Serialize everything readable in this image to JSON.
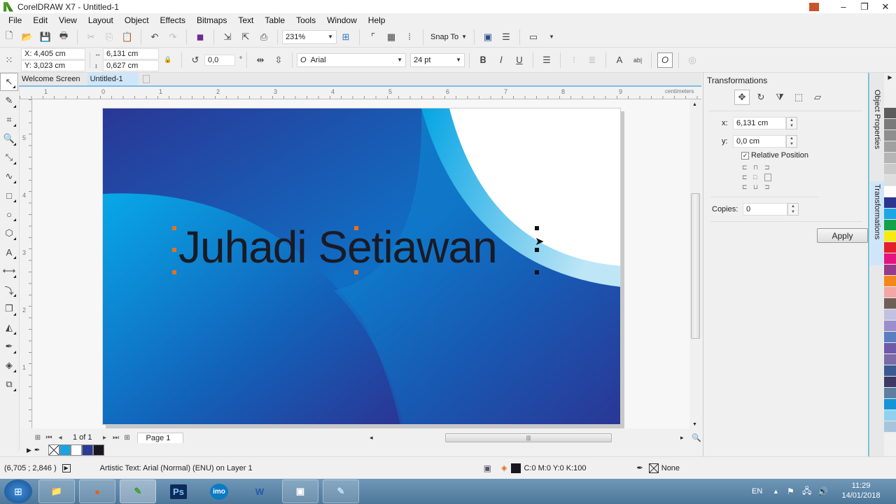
{
  "window": {
    "title": "CorelDRAW X7 - Untitled-1",
    "min": "–",
    "restore": "❐",
    "close": "✕"
  },
  "menu": [
    "File",
    "Edit",
    "View",
    "Layout",
    "Object",
    "Effects",
    "Bitmaps",
    "Text",
    "Table",
    "Tools",
    "Window",
    "Help"
  ],
  "standard_toolbar": {
    "zoom_level": "231%",
    "snap_to": "Snap To"
  },
  "property_bar": {
    "x": "X: 4,405 cm",
    "y": "Y: 3,023 cm",
    "width": "6,131 cm",
    "height": "0,627 cm",
    "rotation": "0,0",
    "degree_symbol": "°",
    "font": "Arial",
    "font_size": "24 pt"
  },
  "doc_tabs": [
    {
      "label": "Welcome Screen",
      "active": false
    },
    {
      "label": "Untitled-1",
      "active": true
    }
  ],
  "rulers": {
    "unit": "centimeters",
    "h_labels": [
      "1",
      "0",
      "1",
      "2",
      "3",
      "4",
      "5",
      "6",
      "7",
      "8",
      "9"
    ],
    "v_labels": [
      "5",
      "4",
      "3",
      "2",
      "1"
    ]
  },
  "canvas": {
    "text_object": "Juhadi Setiawan",
    "text_color": "#1a1a24"
  },
  "page_nav": {
    "counter": "1 of 1",
    "page_tab": "Page 1"
  },
  "document_palette": [
    "none",
    "#1aa3e0",
    "#ffffff",
    "#2b3a94",
    "#1a1620"
  ],
  "transformations_panel": {
    "title": "Transformations",
    "x_label": "x:",
    "x_value": "6,131 cm",
    "y_label": "y:",
    "y_value": "0,0 cm",
    "relative_position_label": "Relative Position",
    "relative_position_checked": true,
    "copies_label": "Copies:",
    "copies_value": "0",
    "apply_label": "Apply"
  },
  "dock_tabs": [
    "Object Properties",
    "Transformations"
  ],
  "color_palette": [
    "#5c5c5c",
    "#7a7a7a",
    "#8e8e8e",
    "#a0a0a0",
    "#b5b5b5",
    "#cacaca",
    "#dedede",
    "#ffffff",
    "#2b3590",
    "#1ea5e6",
    "#12a14a",
    "#f6ea12",
    "#e3202a",
    "#e6147e",
    "#973a8a",
    "#f2871c",
    "#f2a6a6",
    "#6e6058",
    "#c2c1e3",
    "#9a8fcc",
    "#5a7fc0",
    "#6d5aa8",
    "#7b6ba6",
    "#3b5a92",
    "#3e3a66",
    "#5e7fa0",
    "#1594d8",
    "#8fd2f0",
    "#a8c4dc"
  ],
  "status": {
    "coords": "(6,705 ; 2,846 )",
    "object_info": "Artistic Text: Arial (Normal) (ENU) on Layer 1",
    "fill": "C:0 M:0 Y:0 K:100",
    "outline": "None"
  },
  "taskbar": {
    "apps": [
      "Start",
      "File Explorer",
      "Firefox",
      "CorelDRAW",
      "Ps",
      "imo",
      "Word",
      "App",
      "Notepad"
    ],
    "lang": "EN",
    "time": "11:29",
    "date": "14/01/2018"
  }
}
